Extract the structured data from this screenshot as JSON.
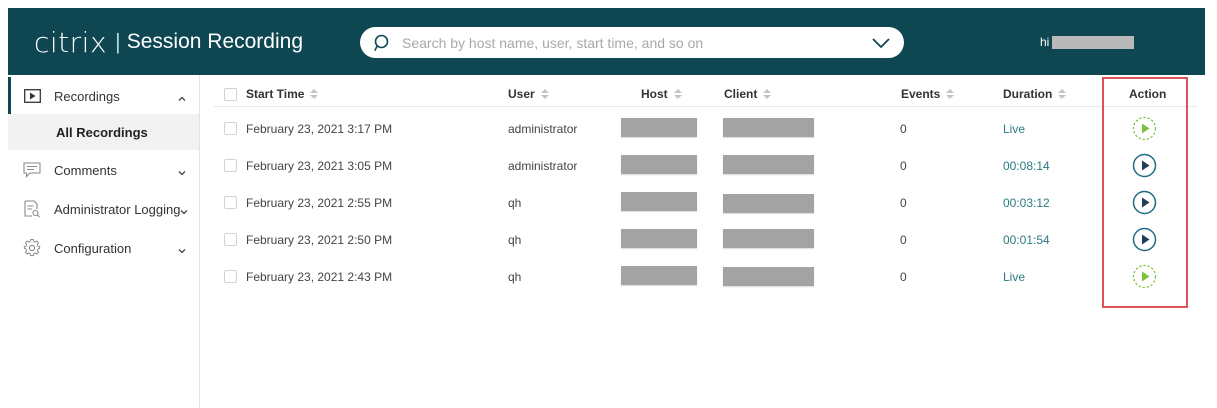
{
  "header": {
    "brand_logo": "citrix",
    "brand_separator": "|",
    "brand_product": "Session Recording",
    "search_placeholder": "Search by host name, user, start time, and so on",
    "search_value": "",
    "user_greeting": "hi",
    "colors": {
      "header_bg": "#0e4651",
      "accent": "#2b7a82",
      "live_green": "#7cc23f",
      "highlight_red": "#e0525a"
    }
  },
  "sidebar": {
    "items": [
      {
        "label": "Recordings",
        "icon": "play-box-icon",
        "expanded": true,
        "children": [
          {
            "label": "All Recordings",
            "selected": true
          }
        ]
      },
      {
        "label": "Comments",
        "icon": "comment-icon",
        "expanded": false
      },
      {
        "label": "Administrator Logging",
        "icon": "log-icon",
        "expanded": false
      },
      {
        "label": "Configuration",
        "icon": "gear-icon",
        "expanded": false
      }
    ]
  },
  "table": {
    "columns": {
      "start_time": "Start Time",
      "user": "User",
      "host": "Host",
      "client": "Client",
      "events": "Events",
      "duration": "Duration",
      "action": "Action"
    },
    "rows": [
      {
        "start_time": "February 23, 2021 3:17 PM",
        "user": "administrator",
        "events": "0",
        "duration": "Live",
        "action": "live-play"
      },
      {
        "start_time": "February 23, 2021 3:05 PM",
        "user": "administrator",
        "events": "0",
        "duration": "00:08:14",
        "action": "play"
      },
      {
        "start_time": "February 23, 2021 2:55 PM",
        "user": "qh",
        "events": "0",
        "duration": "00:03:12",
        "action": "play"
      },
      {
        "start_time": "February 23, 2021 2:50 PM",
        "user": "qh",
        "events": "0",
        "duration": "00:01:54",
        "action": "play"
      },
      {
        "start_time": "February 23, 2021 2:43 PM",
        "user": "qh",
        "events": "0",
        "duration": "Live",
        "action": "live-play"
      }
    ]
  }
}
